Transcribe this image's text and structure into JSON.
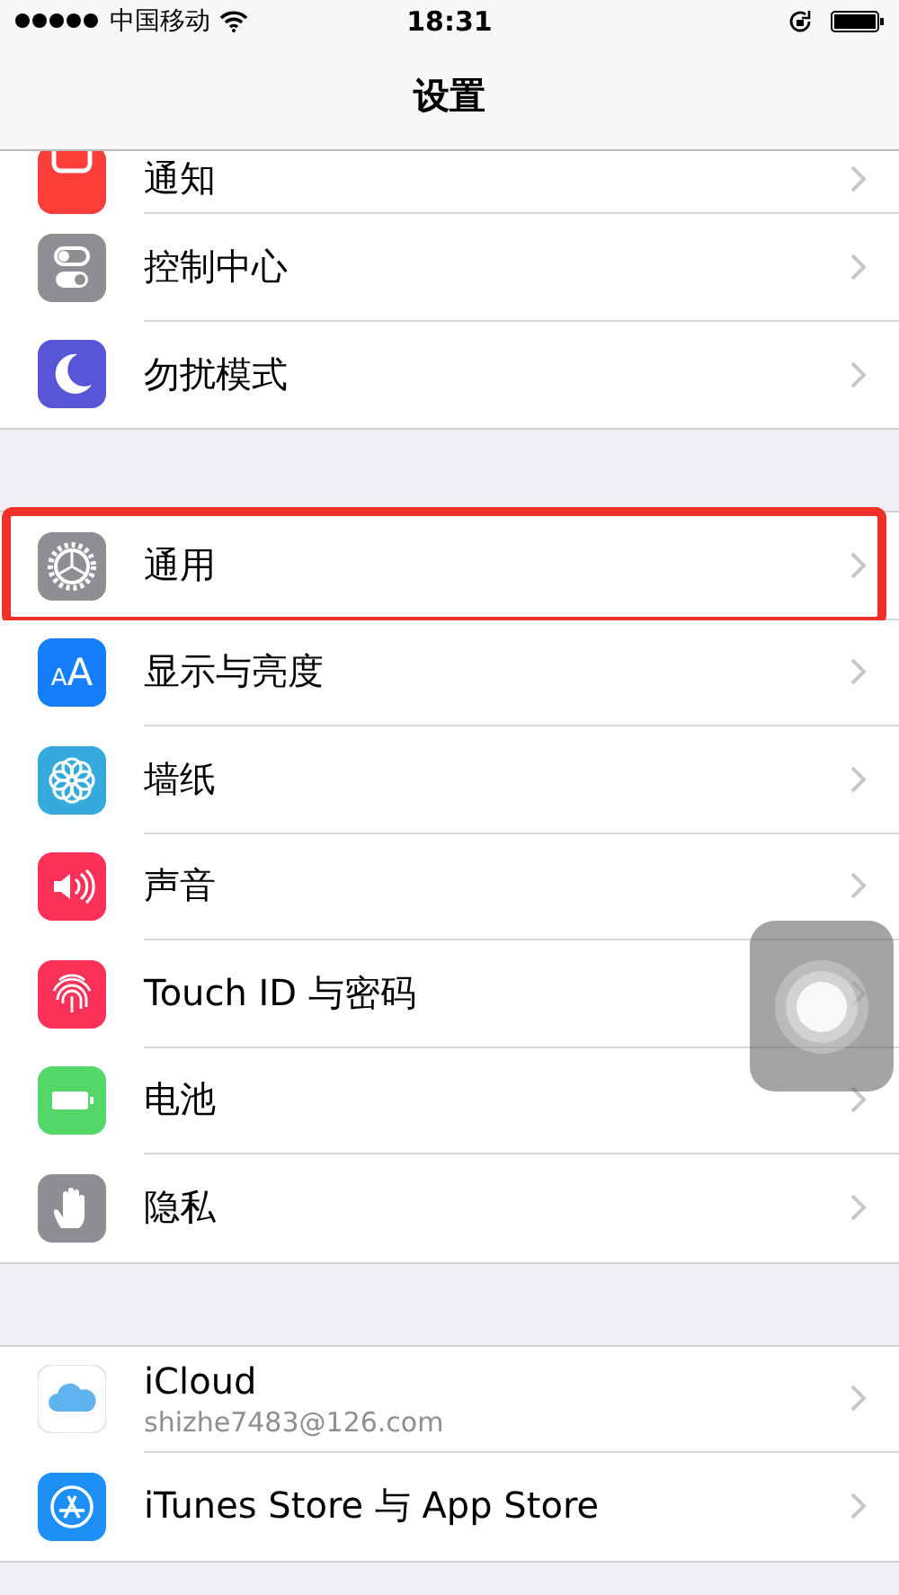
{
  "status_bar": {
    "carrier": "中国移动",
    "time": "18:31"
  },
  "nav_bar": {
    "title": "设置"
  },
  "groups": [
    {
      "rows": [
        {
          "label": "通知",
          "cut_off": true,
          "highlighted": false
        },
        {
          "label": "控制中心",
          "cut_off": false,
          "highlighted": false
        },
        {
          "label": "勿扰模式",
          "cut_off": false,
          "highlighted": false
        }
      ]
    },
    {
      "rows": [
        {
          "label": "通用",
          "cut_off": false,
          "highlighted": true
        },
        {
          "label": "显示与亮度",
          "icon_text": "AA",
          "cut_off": false,
          "highlighted": false
        },
        {
          "label": "墙纸",
          "cut_off": false,
          "highlighted": false
        },
        {
          "label": "声音",
          "cut_off": false,
          "highlighted": false
        },
        {
          "label": "Touch ID 与密码",
          "cut_off": false,
          "highlighted": false
        },
        {
          "label": "电池",
          "cut_off": false,
          "highlighted": false
        },
        {
          "label": "隐私",
          "cut_off": false,
          "highlighted": false
        }
      ]
    },
    {
      "rows": [
        {
          "label": "iCloud",
          "subtitle": "shizhe7483@126.com",
          "cut_off": false,
          "highlighted": false
        },
        {
          "label": "iTunes Store 与 App Store",
          "cut_off": false,
          "highlighted": false
        }
      ]
    }
  ],
  "assistive_touch": {
    "visible": true
  }
}
